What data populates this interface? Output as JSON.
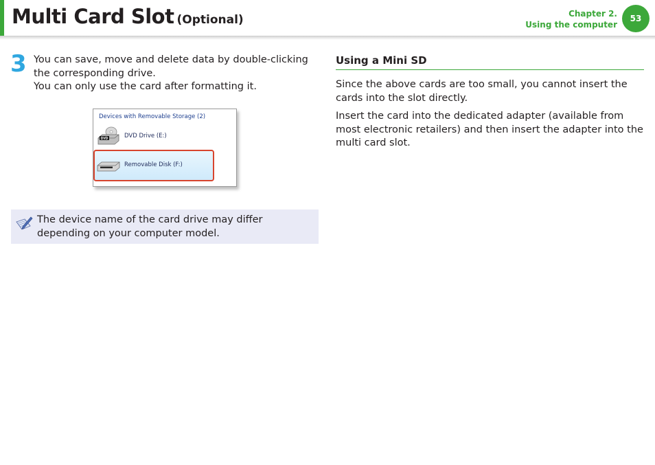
{
  "header": {
    "title": "Multi Card Slot",
    "title_suffix": "(Optional)",
    "chapter": "Chapter 2.",
    "chapter_title": "Using the computer",
    "page_number": "53"
  },
  "step": {
    "number": "3",
    "lines": [
      "You can save, move and delete data by double-clicking the corresponding drive.",
      "You can only use the card after formatting it."
    ]
  },
  "screenshot": {
    "group_header": "Devices with Removable Storage (2)",
    "drives": [
      {
        "label": "DVD Drive (E:)",
        "icon": "dvd-drive-icon",
        "badge": "DVD"
      },
      {
        "label": "Removable Disk (F:)",
        "icon": "removable-disk-icon"
      }
    ]
  },
  "note": {
    "icon": "note-pencil-icon",
    "text": "The device name of the card drive may differ depending on your computer model."
  },
  "right": {
    "heading": "Using a Mini SD",
    "paragraphs": [
      "Since the above cards are too small, you cannot insert the cards into the slot directly.",
      "Insert the card into the dedicated adapter (available from most electronic retailers) and then insert the adapter into the multi card slot."
    ]
  },
  "colors": {
    "accent_green": "#3ca83a",
    "step_blue": "#2fa7e0",
    "highlight_red": "#d8442d",
    "note_bg": "#e9eaf6"
  }
}
